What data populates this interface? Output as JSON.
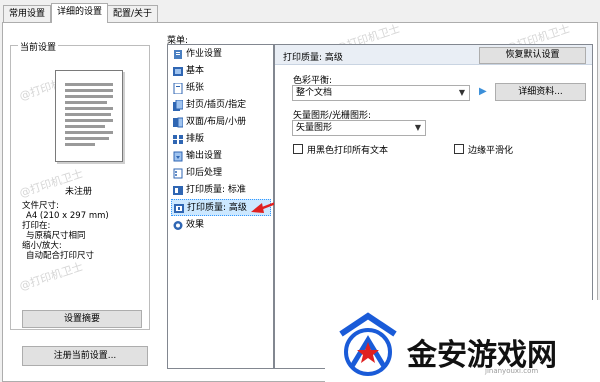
{
  "tabs": [
    {
      "label": "常用设置"
    },
    {
      "label": "详细的设置"
    },
    {
      "label": "配置/关于"
    }
  ],
  "left": {
    "group_title": "当前设置",
    "status": "未注册",
    "info_lines": [
      "文件尺寸:",
      "A4 (210 x 297 mm)",
      "打印在:",
      "与原稿尺寸相同",
      "缩小/放大:",
      "自动配合打印尺寸"
    ],
    "summary_button": "设置摘要",
    "register_button": "注册当前设置..."
  },
  "menu": {
    "label": "菜单:",
    "items": [
      {
        "label": "作业设置",
        "icon": "job-settings-icon"
      },
      {
        "label": "基本",
        "icon": "basic-icon"
      },
      {
        "label": "纸张",
        "icon": "paper-icon"
      },
      {
        "label": "封页/插页/指定",
        "icon": "cover-icon"
      },
      {
        "label": "双面/布局/小册",
        "icon": "duplex-icon"
      },
      {
        "label": "排版",
        "icon": "imposition-icon"
      },
      {
        "label": "输出设置",
        "icon": "output-icon"
      },
      {
        "label": "印后处理",
        "icon": "finishing-icon"
      },
      {
        "label": "打印质量: 标准",
        "icon": "quality-standard-icon"
      },
      {
        "label": "打印质量: 高级",
        "icon": "quality-advanced-icon"
      },
      {
        "label": "效果",
        "icon": "effects-icon"
      }
    ],
    "selected_index": 9
  },
  "pane": {
    "title": "打印质量: 高级",
    "restore_button": "恢复默认设置",
    "color_balance_label": "色彩平衡:",
    "color_balance_value": "整个文档",
    "details_button": "详细资料...",
    "vector_label": "矢量图形/光栅图形:",
    "vector_value": "矢量图形",
    "checkbox_black": "用黑色打印所有文本",
    "checkbox_edge": "边缘平滑化"
  },
  "watermark_text": "@打印机卫士",
  "brand": {
    "name": "金安游戏网",
    "url": "jinanyouxi.com"
  },
  "colors": {
    "selection_bg": "#cce8ff",
    "selection_border": "#3399ff",
    "arrow_red": "#e02020",
    "brand_blue": "#1a5bd8"
  }
}
